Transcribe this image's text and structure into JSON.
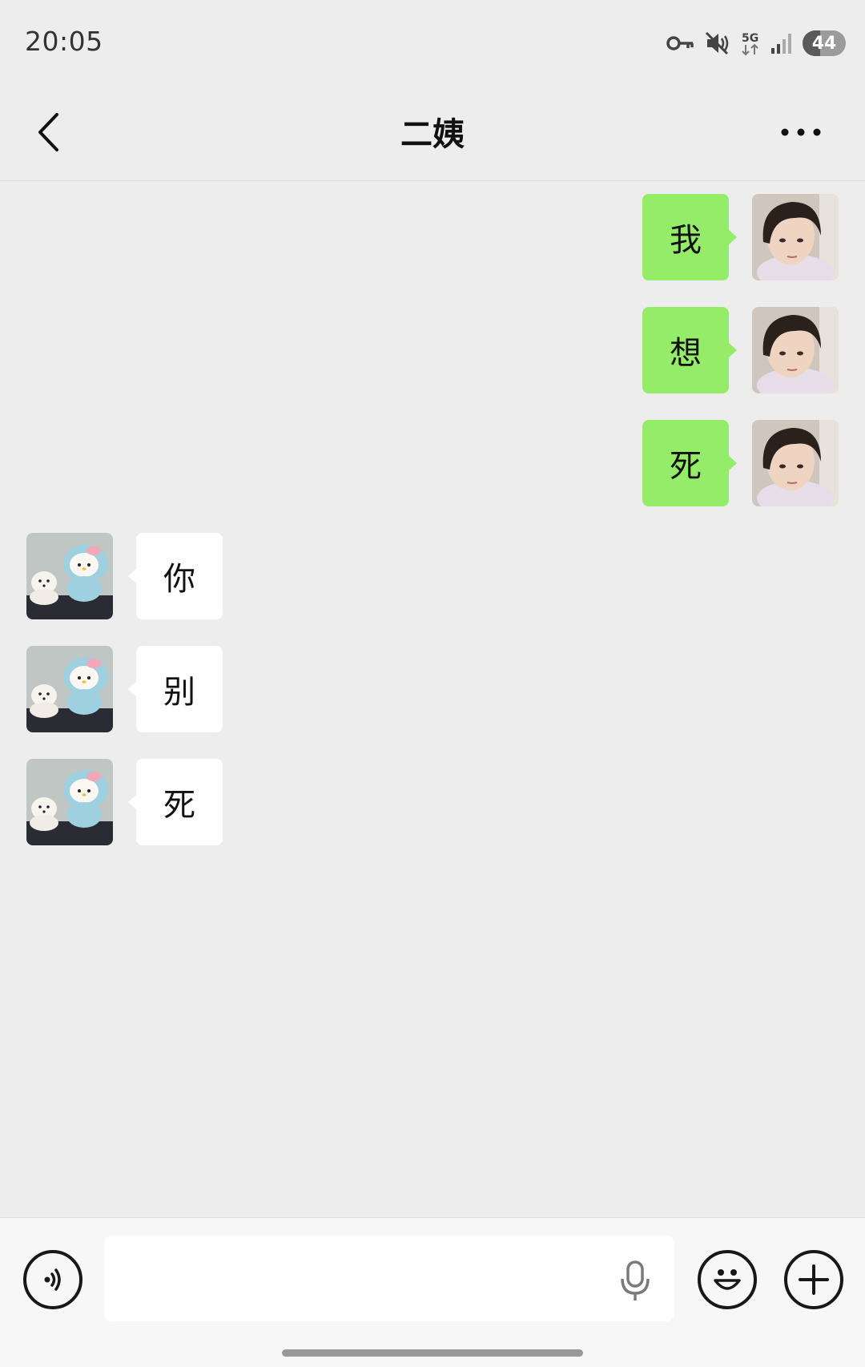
{
  "status_bar": {
    "time": "20:05",
    "icons": [
      "key-icon",
      "mute-icon",
      "5g-icon",
      "signal-icon"
    ],
    "network": "5G",
    "battery": "44"
  },
  "header": {
    "title": "二姨",
    "back_icon": "chevron-left-icon",
    "more_icon": "more-dots-icon"
  },
  "messages": [
    {
      "direction": "sent",
      "text": "我"
    },
    {
      "direction": "sent",
      "text": "想"
    },
    {
      "direction": "sent",
      "text": "死"
    },
    {
      "direction": "received",
      "text": "你"
    },
    {
      "direction": "received",
      "text": "别"
    },
    {
      "direction": "received",
      "text": "死"
    }
  ],
  "input_bar": {
    "voice_icon": "voice-mode-icon",
    "text_value": "",
    "mic_icon": "microphone-icon",
    "emoji_icon": "emoji-icon",
    "plus_icon": "plus-icon"
  },
  "colors": {
    "sent_bubble": "#95ec69",
    "received_bubble": "#ffffff",
    "chat_background": "#ededed"
  }
}
